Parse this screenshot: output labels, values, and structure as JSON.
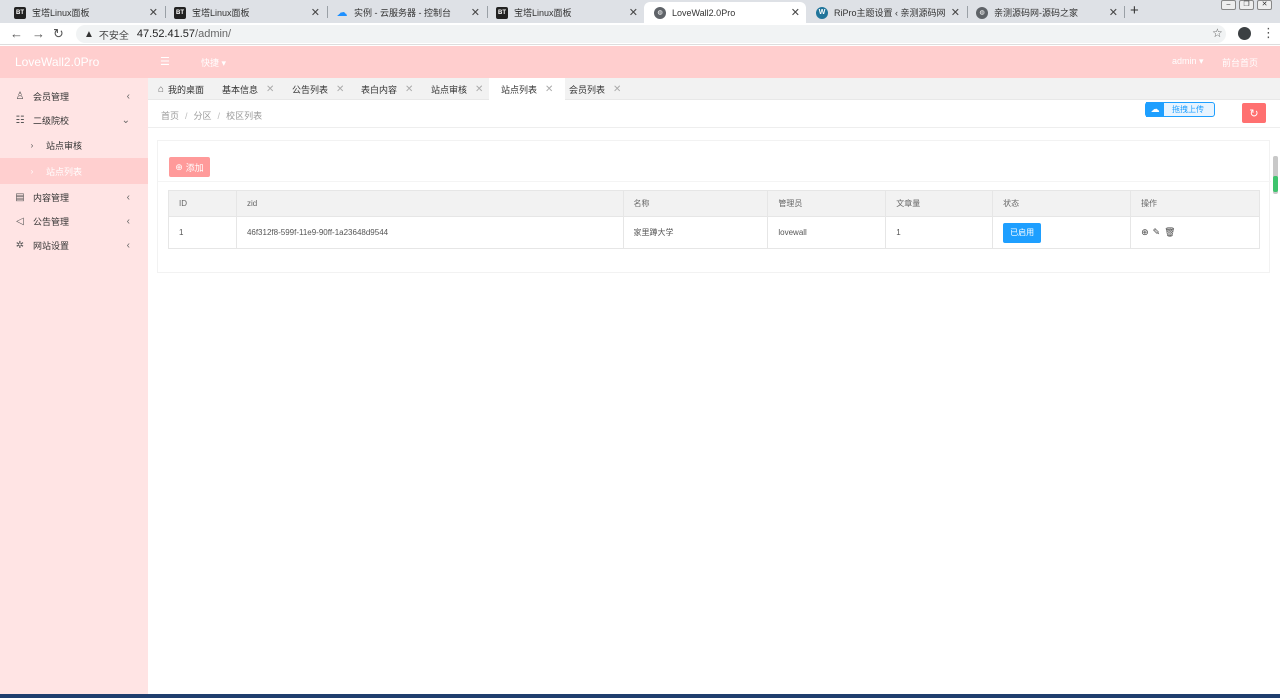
{
  "browser": {
    "tabs": [
      {
        "favicon": "BT",
        "label": "宝塔Linux面板"
      },
      {
        "favicon": "BT",
        "label": "宝塔Linux面板"
      },
      {
        "favicon": "cloud",
        "label": "实例 - 云服务器 - 控制台"
      },
      {
        "favicon": "BT",
        "label": "宝塔Linux面板"
      },
      {
        "favicon": "globe",
        "label": "LoveWall2.0Pro"
      },
      {
        "favicon": "W",
        "label": "RiPro主题设置 ‹ 亲测源码网 — W"
      },
      {
        "favicon": "globe",
        "label": "亲测源码网-源码之家"
      }
    ],
    "active_tab": 4,
    "new_tab": "+",
    "security_label": "不安全",
    "url_host": "47.52.41.57",
    "url_path": "/admin/"
  },
  "app": {
    "logo": "LoveWall2.0Pro",
    "quick_menu": "快捷",
    "user": "admin",
    "front_home": "前台首页"
  },
  "sidebar": {
    "items": [
      {
        "label": "会员管理",
        "icon": "user-icon",
        "glyph": "♙",
        "chevron": "‹"
      },
      {
        "label": "二级院校",
        "icon": "list-icon",
        "glyph": "☷",
        "chevron": "⌄"
      },
      {
        "label": "站点审核",
        "icon": "chevron-right-icon",
        "glyph": "›"
      },
      {
        "label": "站点列表",
        "icon": "chevron-right-icon",
        "glyph": "›"
      },
      {
        "label": "内容管理",
        "icon": "content-icon",
        "glyph": "▤",
        "chevron": "‹"
      },
      {
        "label": "公告管理",
        "icon": "speaker-icon",
        "glyph": "◁",
        "chevron": "‹"
      },
      {
        "label": "网站设置",
        "icon": "gear-icon",
        "glyph": "✲",
        "chevron": "‹"
      }
    ]
  },
  "page_tabs": [
    {
      "label": "我的桌面"
    },
    {
      "label": "基本信息"
    },
    {
      "label": "公告列表"
    },
    {
      "label": "表白内容"
    },
    {
      "label": "站点审核"
    },
    {
      "label": "站点列表"
    },
    {
      "label": "会员列表"
    }
  ],
  "breadcrumb": [
    "首页",
    "分区",
    "校区列表"
  ],
  "upload_label": "拖拽上传",
  "add_button": "添加",
  "table": {
    "headers": [
      "ID",
      "zid",
      "名称",
      "管理员",
      "文章量",
      "状态",
      "操作"
    ],
    "rows": [
      {
        "id": "1",
        "zid": "46f312f8-599f-11e9-90ff-1a23648d9544",
        "name": "家里蹲大学",
        "admin": "lovewall",
        "articles": "1",
        "status": "已启用"
      }
    ]
  },
  "colors": {
    "header": "#ffcece",
    "sidebar": "#ffe4e4",
    "primary": "#1e9fff",
    "add_button": "#ff9a9a",
    "refresh": "#ff7070"
  }
}
